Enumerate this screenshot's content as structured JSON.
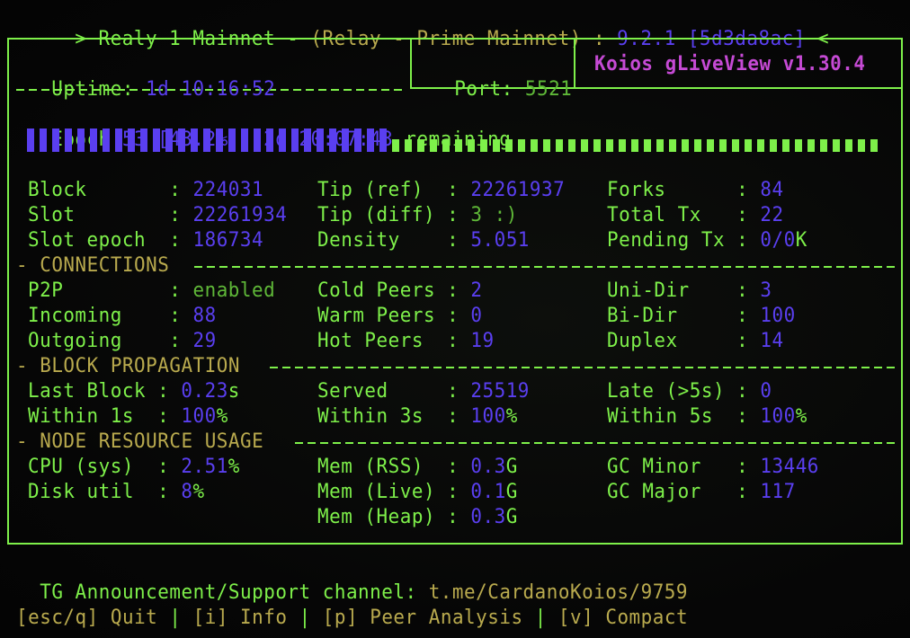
{
  "title": {
    "prefix": " > ",
    "node_name": "Realy 1 Mainnet - ",
    "node_desc": "(Relay - Prime Mainnet)",
    "sep": " : ",
    "version": "9.2.1",
    "commit": "[5d3da8ac]",
    "suffix": " <"
  },
  "header": {
    "uptime_label": "Uptime: ",
    "uptime_value": "1d 10:16:52",
    "port_label": "Port: ",
    "port_value": "5521",
    "app_name": "Koios gLiveView v1.30.4"
  },
  "epoch": {
    "label": "Epoch ",
    "number": "53",
    "percent": "[43.2%]",
    "comma": ", ",
    "remaining_time": "2d 20:07:43",
    "remaining_label": " remaining",
    "progress": 0.432,
    "filled_cells": 29,
    "empty_cells": 39
  },
  "chain": [
    {
      "l1": "Block       : ",
      "v1": "224031",
      "l2": "Tip (ref)  : ",
      "v2": "22261937",
      "l3": "Forks      : ",
      "v3": "84"
    },
    {
      "l1": "Slot        : ",
      "v1": "22261934",
      "l2": "Tip (diff) : ",
      "v2": "3 :)",
      "l3": "Total Tx   : ",
      "v3": "22"
    },
    {
      "l1": "Slot epoch  : ",
      "v1": "186734",
      "l2": "Density    : ",
      "v2": "5.051",
      "l3": "Pending Tx : ",
      "v3": "0/0",
      "v3u": "K"
    }
  ],
  "sections": {
    "connections": "CONNECTIONS",
    "propagation": "BLOCK PROPAGATION",
    "resources": "NODE RESOURCE USAGE"
  },
  "connections": [
    {
      "l1": "P2P         : ",
      "v1": "enabled",
      "l2": "Cold Peers : ",
      "v2": "2",
      "l3": "Uni-Dir    : ",
      "v3": "3"
    },
    {
      "l1": "Incoming    : ",
      "v1": "88",
      "l2": "Warm Peers : ",
      "v2": "0",
      "l3": "Bi-Dir     : ",
      "v3": "100"
    },
    {
      "l1": "Outgoing    : ",
      "v1": "29",
      "l2": "Hot Peers  : ",
      "v2": "19",
      "l3": "Duplex     : ",
      "v3": "14"
    }
  ],
  "propagation": [
    {
      "l1": "Last Block : ",
      "v1": "0.23",
      "u1": "s",
      "l2": "Served     : ",
      "v2": "25519",
      "u2": "",
      "l3": "Late (>5s) : ",
      "v3": "0",
      "u3": ""
    },
    {
      "l1": "Within 1s  : ",
      "v1": "100",
      "u1": "%",
      "l2": "Within 3s  : ",
      "v2": "100",
      "u2": "%",
      "l3": "Within 5s  : ",
      "v3": "100",
      "u3": "%"
    }
  ],
  "resources": [
    {
      "l1": "CPU (sys)  : ",
      "v1": "2.51",
      "u1": "%",
      "l2": "Mem (RSS)  : ",
      "v2": "0.3",
      "u2": "G",
      "l3": "GC Minor   : ",
      "v3": "13446"
    },
    {
      "l1": "Disk util  : ",
      "v1": "8",
      "u1": "%",
      "l2": "Mem (Live) : ",
      "v2": "0.1",
      "u2": "G",
      "l3": "GC Major   : ",
      "v3": "117"
    },
    {
      "l2": "Mem (Heap) : ",
      "v2": "0.3",
      "u2": "G"
    }
  ],
  "footer": {
    "tg_label": "TG Announcement/Support channel: ",
    "tg_link": "t.me/CardanoKoios/9759",
    "keys": [
      {
        "key": "[esc/q]",
        "label": " Quit"
      },
      {
        "key": "[i]",
        "label": " Info"
      },
      {
        "key": "[p]",
        "label": " Peer Analysis"
      },
      {
        "key": "[v]",
        "label": " Compact"
      }
    ],
    "separator": " | "
  }
}
